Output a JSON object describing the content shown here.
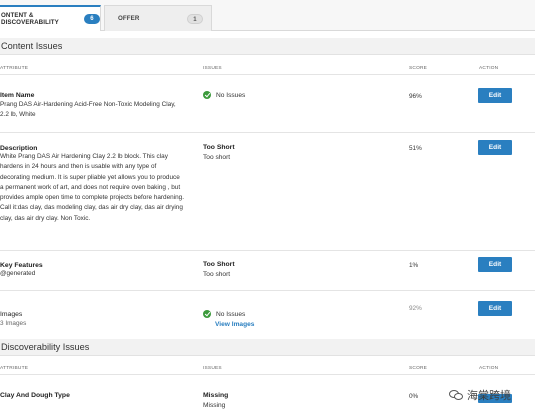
{
  "tabs": {
    "content": {
      "label": "ONTENT & DISCOVERABILITY",
      "count": "6"
    },
    "offer": {
      "label": "OFFER",
      "count": "1"
    }
  },
  "content_issues": {
    "title": "Content Issues",
    "columns": {
      "attribute": "ATTRIBUTE",
      "issues": "ISSUES",
      "score": "SCORE",
      "action": "ACTION"
    },
    "rows": [
      {
        "name": "Item Name",
        "value": "Prang DAS Air-Hardening Acid-Free Non-Toxic Modeling Clay, 2.2 lb, White",
        "issue": "No Issues",
        "score": "96%",
        "action": "Edit"
      },
      {
        "name": "Description",
        "value": "White Prang DAS Air Hardening Clay 2.2 lb block. This clay hardens in 24 hours and then is usable with any type of decorating medium. It is super pliable yet allows you to produce a permanent work of art, and does not require oven baking , but provides ample open time to complete projects before hardening. Call it:das clay, das modeling clay, das air dry clay, das air drying clay, das air dry clay. Non Toxic.",
        "issue_title": "Too Short",
        "issue_sub": "Too short",
        "score": "51%",
        "action": "Edit"
      },
      {
        "name": "Key Features",
        "value": "@generated",
        "issue_title": "Too Short",
        "issue_sub": "Too short",
        "score": "1%",
        "action": "Edit"
      },
      {
        "name": "Images",
        "value": "3 Images",
        "issue": "No Issues",
        "link": "View Images",
        "score": "92%",
        "action": "Edit"
      }
    ]
  },
  "discoverability_issues": {
    "title": "Discoverability Issues",
    "columns": {
      "attribute": "ATTRIBUTE",
      "issues": "ISSUES",
      "score": "SCORE",
      "action": "ACTION"
    },
    "rows": [
      {
        "name": "Clay And Dough Type",
        "issue_title": "Missing",
        "issue_sub": "Missing",
        "score": "0%"
      }
    ]
  },
  "watermark": "海棠跨境",
  "colors": {
    "accent": "#2a7fc0",
    "ok": "#3c9a3c"
  }
}
